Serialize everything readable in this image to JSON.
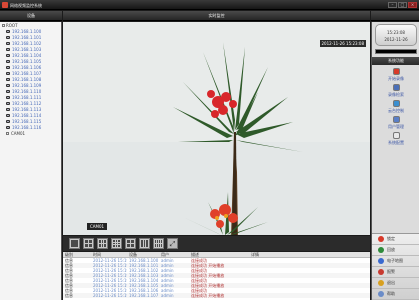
{
  "window": {
    "title": "网络视频监控系统",
    "buttons": [
      "–",
      "□",
      "×"
    ]
  },
  "device_panel": {
    "header": "设备",
    "root_label": "ROOT",
    "devices": [
      "192.168.1.100",
      "192.168.1.101",
      "192.168.1.102",
      "192.168.1.103",
      "192.168.1.104",
      "192.168.1.105",
      "192.168.1.106",
      "192.168.1.107",
      "192.168.1.108",
      "192.168.1.109",
      "192.168.1.110",
      "192.168.1.111",
      "192.168.1.112",
      "192.168.1.113",
      "192.168.1.114",
      "192.168.1.115",
      "192.168.1.116"
    ],
    "group_label": "CAM01"
  },
  "video": {
    "header": "实时监控",
    "osd_time": "2012-11-26 15:23:08",
    "camera_label": "CAM01"
  },
  "layout_buttons": [
    "1画面",
    "4画面",
    "6画面",
    "8画面",
    "9画面",
    "13画面",
    "16画面",
    "全屏"
  ],
  "log": {
    "columns": [
      "级别",
      "时间",
      "设备",
      "用户",
      "描述",
      "详情"
    ],
    "rows": [
      {
        "level": "信息",
        "time": "2012-11-26 15:19:05",
        "device": "192.168.1.100",
        "user": "admin",
        "msg": "连接成功"
      },
      {
        "level": "信息",
        "time": "2012-11-26 15:19:06",
        "device": "192.168.1.101",
        "user": "admin",
        "msg": "连接成功 开始播放"
      },
      {
        "level": "信息",
        "time": "2012-11-26 15:19:08",
        "device": "192.168.1.102",
        "user": "admin",
        "msg": "连接成功"
      },
      {
        "level": "信息",
        "time": "2012-11-26 15:19:10",
        "device": "192.168.1.103",
        "user": "admin",
        "msg": "连接成功 开始播放"
      },
      {
        "level": "信息",
        "time": "2012-11-26 15:19:12",
        "device": "192.168.1.104",
        "user": "admin",
        "msg": "连接成功"
      },
      {
        "level": "信息",
        "time": "2012-11-26 15:19:14",
        "device": "192.168.1.105",
        "user": "admin",
        "msg": "连接成功 开始播放"
      },
      {
        "level": "信息",
        "time": "2012-11-26 15:19:16",
        "device": "192.168.1.106",
        "user": "admin",
        "msg": "连接成功"
      },
      {
        "level": "信息",
        "time": "2012-11-26 15:19:18",
        "device": "192.168.1.107",
        "user": "admin",
        "msg": "连接成功 开始播放"
      }
    ]
  },
  "right_panel": {
    "clock_time": "15:23:08",
    "clock_date": "2012-11-26",
    "func_header": "系统功能",
    "functions": [
      {
        "label": "开始录像",
        "icon": "record-icon",
        "color": "#d83a2a"
      },
      {
        "label": "录像检索",
        "icon": "playback-icon",
        "color": "#4a6fb8"
      },
      {
        "label": "云台控制",
        "icon": "ptz-icon",
        "color": "#3b8fd0"
      },
      {
        "label": "用户管理",
        "icon": "users-icon",
        "color": "#5a7fc8"
      },
      {
        "label": "系统配置",
        "icon": "config-icon",
        "color": "#e8e8e8"
      }
    ],
    "bottom_menu": [
      {
        "label": "锁定",
        "icon": "lock-icon",
        "color": "#d83a2a"
      },
      {
        "label": "回放",
        "icon": "playback-icon",
        "color": "#2e8b3a"
      },
      {
        "label": "电子地图",
        "icon": "map-icon",
        "color": "#3a6ad0"
      },
      {
        "label": "报警",
        "icon": "alarm-icon",
        "color": "#c83a30"
      },
      {
        "label": "退出",
        "icon": "exit-icon",
        "color": "#d8a020"
      },
      {
        "label": "帮助",
        "icon": "help-icon",
        "color": "#6a8cc8"
      }
    ]
  },
  "colors": {
    "accent": "#d83a2a",
    "link": "#4467b8",
    "dark_chrome": "#1b1b1b"
  }
}
